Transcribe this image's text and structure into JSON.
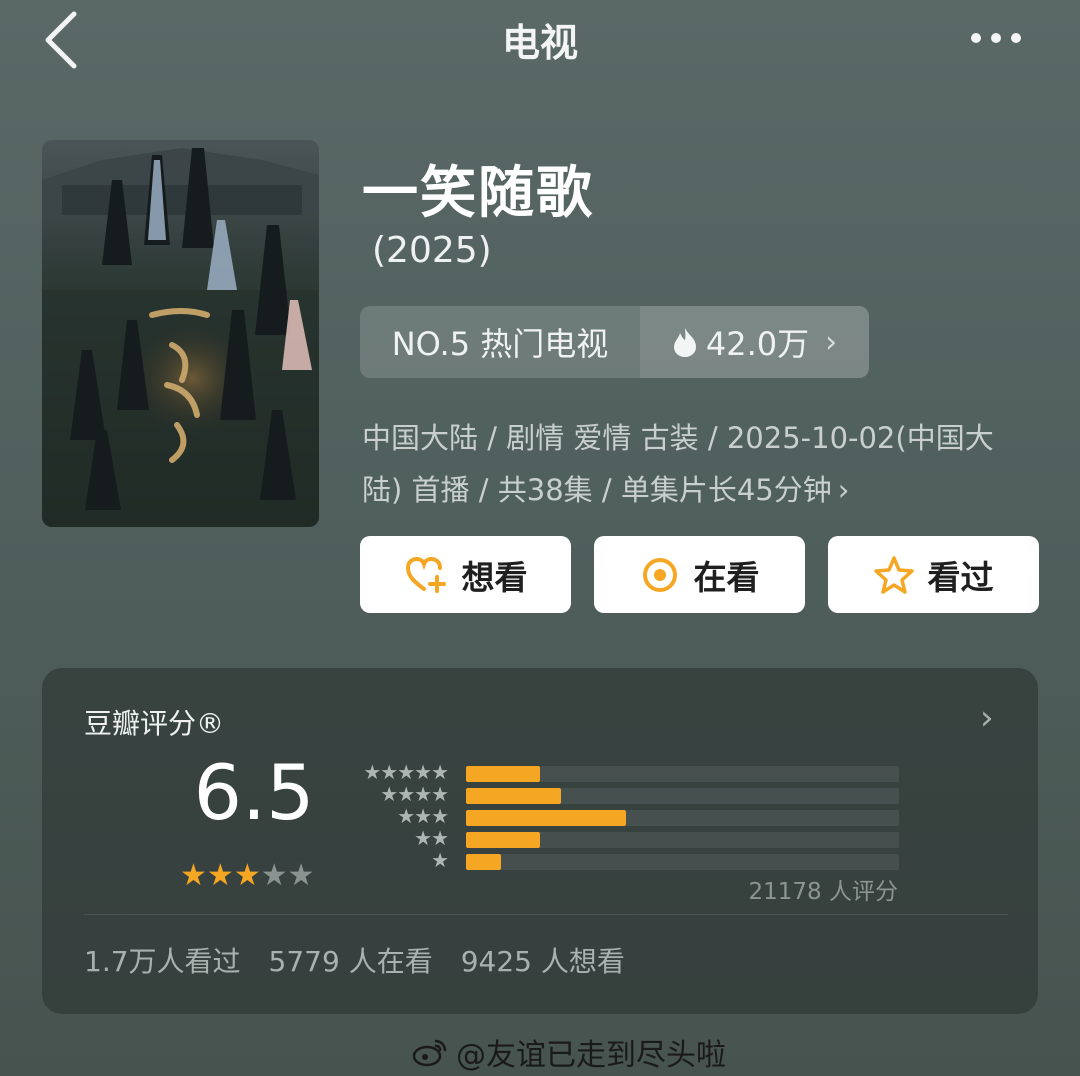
{
  "nav": {
    "title": "电视"
  },
  "show": {
    "title": "一笑随歌",
    "year": "(2025)",
    "rank_label": "NO.5 热门电视",
    "heat": "42.0万",
    "meta": "中国大陆 / 剧情 爱情 古装 / 2025-10-02(中国大陆) 首播 / 共38集 / 单集片长45分钟"
  },
  "actions": {
    "want": "想看",
    "watching": "在看",
    "watched": "看过"
  },
  "rating": {
    "label": "豆瓣评分®",
    "score": "6.5",
    "stars": 3,
    "star_total": 5,
    "distribution_percent": [
      17,
      22,
      37,
      17,
      8
    ],
    "count_text": "21178 人评分",
    "stats": {
      "watched": "1.7万人看过",
      "watching": "5779 人在看",
      "want": "9425 人想看"
    }
  },
  "watermark": {
    "handle": "@友谊已走到尽头啦"
  },
  "colors": {
    "accent": "#f5a623",
    "card_bg": "#2e3735",
    "background": "#55635f"
  },
  "icons": [
    "chevron-left-icon",
    "more-dots-icon",
    "flame-icon",
    "heart-plus-icon",
    "target-icon",
    "star-icon",
    "weibo-logo-icon"
  ]
}
